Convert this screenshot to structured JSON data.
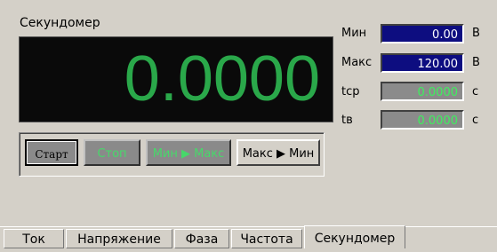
{
  "panel": {
    "title": "Секундомер"
  },
  "display": {
    "value": "0.0000"
  },
  "buttons": {
    "start": "Старт",
    "stop": "Стоп",
    "min_to_max": "Мин ▶ Макс",
    "max_to_min": "Макс ▶ Мин"
  },
  "fields": [
    {
      "label": "Мин",
      "value": "0.00",
      "unit": "В"
    },
    {
      "label": "Макс",
      "value": "120.00",
      "unit": "В"
    },
    {
      "label": "tср",
      "value": "0.0000",
      "unit": "с"
    },
    {
      "label": "tв",
      "value": "0.0000",
      "unit": "с"
    }
  ],
  "tabs": [
    "Ток",
    "Напряжение",
    "Фаза",
    "Частота",
    "Секундомер"
  ],
  "active_tab": "Секундомер",
  "colors": {
    "display_bg": "#0a0a0a",
    "digits": "#2aa84a",
    "field_blue": "#0d0d80",
    "field_grey": "#8b8b8b"
  }
}
